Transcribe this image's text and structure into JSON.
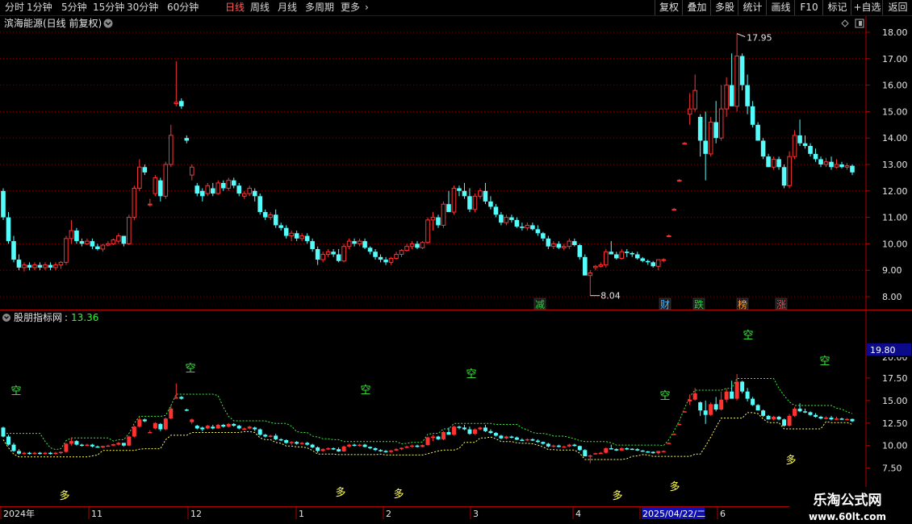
{
  "periods": [
    {
      "label": "分时",
      "active": false
    },
    {
      "label": "1分钟",
      "active": false
    },
    {
      "label": "5分钟",
      "active": false
    },
    {
      "label": "15分钟",
      "active": false
    },
    {
      "label": "30分钟",
      "active": false
    },
    {
      "label": "60分钟",
      "active": false
    },
    {
      "label": "日线",
      "active": true
    },
    {
      "label": "周线",
      "active": false
    },
    {
      "label": "月线",
      "active": false
    },
    {
      "label": "多周期",
      "active": false
    },
    {
      "label": "更多",
      "active": false
    }
  ],
  "more_chevron": "›",
  "toolbar": [
    "复权",
    "叠加",
    "多股",
    "统计",
    "画线",
    "F10",
    "标记",
    "+自选",
    "返回"
  ],
  "main": {
    "title": "滨海能源(日线 前复权)",
    "high_label": "17.95",
    "low_label": "8.04",
    "y_ticks": [
      "18.00",
      "17.00",
      "16.00",
      "15.00",
      "14.00",
      "13.00",
      "12.00",
      "11.00",
      "10.00",
      "9.00",
      "8.00"
    ],
    "events": [
      {
        "text": "减",
        "color": "#2ecc40"
      },
      {
        "text": "财",
        "color": "#4ab8ff"
      },
      {
        "text": "跌",
        "color": "#2ecc40"
      },
      {
        "text": "榜",
        "color": "#ffa040"
      },
      {
        "text": "涨",
        "color": "#ff4040"
      }
    ]
  },
  "indicator": {
    "name": "股朋指标网",
    "value": "13.36",
    "current_tag": "19.80",
    "y_ticks": [
      "17.50",
      "15.00",
      "12.50",
      "10.00",
      "7.50"
    ],
    "partial_tick": "20.00",
    "kong_label": "空",
    "duo_label": "多"
  },
  "dates": [
    "2024年",
    "11",
    "12",
    "1",
    "2",
    "3",
    "4",
    "2025/04/22/二",
    "6"
  ],
  "watermark": {
    "title": "乐淘公式网",
    "url": "www.60lt.com"
  },
  "colors": {
    "up": "#ff3232",
    "down": "#54fcfc",
    "grid": "#8a0000",
    "axis": "#b00000",
    "kong": "#3cf03c",
    "duo": "#ffff50"
  },
  "chart_data": {
    "type": "candlestick",
    "ylim": [
      7.8,
      18.3
    ],
    "candles": [
      [
        12.0,
        12.1,
        10.9,
        11.0
      ],
      [
        11.0,
        11.2,
        10.0,
        10.1
      ],
      [
        10.1,
        10.3,
        9.3,
        9.4
      ],
      [
        9.4,
        9.6,
        9.0,
        9.1
      ],
      [
        9.1,
        9.3,
        8.95,
        9.2
      ],
      [
        9.2,
        9.3,
        9.0,
        9.1
      ],
      [
        9.1,
        9.3,
        9.0,
        9.2
      ],
      [
        9.2,
        9.3,
        9.0,
        9.1
      ],
      [
        9.1,
        9.3,
        9.0,
        9.2
      ],
      [
        9.2,
        9.3,
        9.0,
        9.1
      ],
      [
        9.1,
        9.3,
        9.0,
        9.2
      ],
      [
        9.2,
        9.35,
        9.05,
        9.3
      ],
      [
        9.3,
        10.3,
        9.2,
        10.2
      ],
      [
        10.2,
        10.9,
        10.0,
        10.5
      ],
      [
        10.5,
        10.6,
        10.0,
        10.1
      ],
      [
        10.1,
        10.2,
        9.9,
        10.0
      ],
      [
        10.0,
        10.2,
        9.95,
        10.1
      ],
      [
        10.1,
        10.2,
        9.8,
        9.9
      ],
      [
        9.9,
        10.0,
        9.75,
        9.8
      ],
      [
        9.8,
        10.0,
        9.7,
        9.95
      ],
      [
        9.95,
        10.1,
        9.9,
        10.0
      ],
      [
        10.0,
        10.2,
        9.95,
        10.15
      ],
      [
        10.1,
        10.4,
        10.0,
        10.3
      ],
      [
        10.3,
        10.2,
        9.9,
        10.0
      ],
      [
        10.0,
        11.1,
        9.95,
        11.0
      ],
      [
        11.0,
        12.2,
        10.9,
        12.1
      ],
      [
        12.1,
        13.2,
        12.0,
        12.9
      ],
      [
        12.9,
        13.0,
        12.6,
        12.7
      ],
      [
        11.5,
        11.7,
        11.4,
        11.5
      ],
      [
        11.9,
        12.6,
        11.8,
        12.5
      ],
      [
        12.4,
        12.5,
        11.6,
        11.8
      ],
      [
        11.8,
        13.1,
        11.7,
        13.0
      ],
      [
        13.0,
        14.5,
        12.9,
        14.1
      ],
      [
        15.3,
        16.9,
        15.2,
        15.35
      ],
      [
        15.4,
        15.5,
        15.1,
        15.2
      ],
      [
        14.0,
        14.1,
        13.8,
        13.9
      ],
      [
        12.6,
        13.0,
        12.4,
        12.9
      ],
      [
        12.2,
        12.3,
        11.8,
        11.9
      ],
      [
        12.0,
        12.1,
        11.6,
        11.8
      ],
      [
        11.9,
        12.3,
        11.8,
        12.2
      ],
      [
        12.1,
        12.3,
        11.8,
        11.9
      ],
      [
        11.9,
        12.4,
        11.85,
        12.3
      ],
      [
        12.3,
        12.4,
        12.0,
        12.1
      ],
      [
        12.1,
        12.5,
        12.0,
        12.4
      ],
      [
        12.4,
        12.5,
        12.1,
        12.2
      ],
      [
        12.2,
        12.3,
        11.8,
        11.9
      ],
      [
        11.8,
        12.0,
        11.7,
        11.9
      ],
      [
        11.9,
        12.2,
        11.8,
        12.1
      ],
      [
        12.0,
        12.1,
        11.6,
        11.8
      ],
      [
        11.8,
        11.9,
        11.1,
        11.2
      ],
      [
        11.2,
        11.3,
        10.9,
        11.0
      ],
      [
        11.0,
        11.2,
        10.9,
        11.1
      ],
      [
        11.1,
        11.3,
        10.6,
        10.7
      ],
      [
        10.7,
        10.8,
        10.5,
        10.6
      ],
      [
        10.6,
        10.7,
        10.2,
        10.3
      ],
      [
        10.3,
        10.5,
        10.1,
        10.4
      ],
      [
        10.4,
        10.5,
        10.1,
        10.2
      ],
      [
        10.2,
        10.4,
        10.1,
        10.3
      ],
      [
        10.3,
        10.4,
        10.0,
        10.1
      ],
      [
        10.1,
        10.2,
        9.7,
        9.8
      ],
      [
        9.8,
        9.9,
        9.2,
        9.4
      ],
      [
        9.4,
        9.7,
        9.3,
        9.6
      ],
      [
        9.6,
        9.8,
        9.5,
        9.7
      ],
      [
        9.7,
        9.8,
        9.5,
        9.6
      ],
      [
        9.6,
        9.8,
        9.3,
        9.35
      ],
      [
        9.35,
        10.0,
        9.3,
        9.9
      ],
      [
        9.9,
        10.2,
        9.8,
        10.1
      ],
      [
        10.1,
        10.2,
        9.9,
        10.0
      ],
      [
        10.0,
        10.2,
        9.9,
        10.1
      ],
      [
        10.1,
        10.2,
        9.8,
        9.85
      ],
      [
        9.85,
        9.9,
        9.6,
        9.7
      ],
      [
        9.7,
        9.8,
        9.4,
        9.5
      ],
      [
        9.5,
        9.6,
        9.3,
        9.4
      ],
      [
        9.4,
        9.5,
        9.2,
        9.3
      ],
      [
        9.3,
        9.5,
        9.2,
        9.45
      ],
      [
        9.45,
        9.7,
        9.4,
        9.6
      ],
      [
        9.6,
        9.8,
        9.5,
        9.75
      ],
      [
        9.75,
        10.0,
        9.7,
        9.9
      ],
      [
        9.9,
        10.1,
        9.8,
        10.0
      ],
      [
        10.0,
        10.1,
        9.8,
        9.85
      ],
      [
        9.85,
        10.1,
        9.8,
        10.05
      ],
      [
        10.05,
        11.0,
        10.0,
        10.9
      ],
      [
        10.9,
        11.2,
        10.5,
        11.0
      ],
      [
        11.0,
        11.1,
        10.6,
        10.7
      ],
      [
        10.7,
        11.6,
        10.6,
        11.5
      ],
      [
        11.5,
        12.0,
        11.4,
        11.2
      ],
      [
        11.2,
        12.2,
        11.1,
        12.1
      ],
      [
        12.1,
        12.2,
        11.8,
        12.0
      ],
      [
        12.0,
        12.3,
        11.7,
        11.8
      ],
      [
        11.8,
        12.1,
        11.2,
        11.3
      ],
      [
        11.3,
        11.9,
        11.2,
        11.8
      ],
      [
        11.8,
        12.1,
        11.7,
        12.0
      ],
      [
        12.0,
        12.3,
        11.5,
        11.6
      ],
      [
        11.6,
        11.8,
        11.3,
        11.4
      ],
      [
        11.4,
        11.5,
        11.0,
        11.1
      ],
      [
        11.1,
        11.2,
        10.7,
        10.8
      ],
      [
        10.8,
        11.1,
        10.7,
        11.0
      ],
      [
        11.0,
        11.1,
        10.8,
        10.9
      ],
      [
        10.9,
        11.0,
        10.6,
        10.65
      ],
      [
        10.65,
        10.8,
        10.5,
        10.6
      ],
      [
        10.6,
        10.8,
        10.5,
        10.7
      ],
      [
        10.7,
        10.8,
        10.5,
        10.55
      ],
      [
        10.55,
        10.7,
        10.3,
        10.4
      ],
      [
        10.4,
        10.45,
        10.1,
        10.2
      ],
      [
        10.2,
        10.3,
        9.8,
        9.9
      ],
      [
        9.9,
        10.1,
        9.8,
        10.0
      ],
      [
        10.0,
        10.1,
        9.8,
        9.85
      ],
      [
        9.85,
        10.0,
        9.75,
        9.9
      ],
      [
        9.9,
        10.2,
        9.8,
        10.1
      ],
      [
        10.1,
        10.2,
        9.9,
        9.95
      ],
      [
        9.95,
        10.0,
        9.4,
        9.5
      ],
      [
        9.5,
        9.6,
        9.0,
        8.8
      ],
      [
        8.8,
        9.0,
        8.04,
        8.9
      ],
      [
        9.1,
        9.2,
        9.0,
        9.15
      ],
      [
        9.15,
        9.3,
        9.1,
        9.2
      ],
      [
        9.2,
        9.8,
        9.1,
        9.7
      ],
      [
        9.7,
        10.1,
        9.6,
        9.6
      ],
      [
        9.6,
        9.7,
        9.4,
        9.45
      ],
      [
        9.45,
        9.8,
        9.4,
        9.7
      ],
      [
        9.7,
        9.8,
        9.5,
        9.65
      ],
      [
        9.65,
        9.7,
        9.5,
        9.6
      ],
      [
        9.6,
        9.7,
        9.4,
        9.45
      ],
      [
        9.45,
        9.5,
        9.3,
        9.35
      ],
      [
        9.35,
        9.4,
        9.2,
        9.3
      ],
      [
        9.3,
        9.35,
        9.1,
        9.15
      ],
      [
        9.15,
        9.4,
        9.0,
        9.4
      ],
      [
        9.4,
        9.45,
        9.3,
        9.4
      ],
      [
        10.3,
        10.35,
        10.25,
        10.3
      ],
      [
        11.3,
        11.35,
        11.25,
        11.3
      ],
      [
        12.4,
        12.45,
        12.35,
        12.4
      ],
      [
        13.8,
        13.85,
        13.75,
        13.8
      ],
      [
        14.9,
        15.7,
        14.5,
        15.1
      ],
      [
        15.1,
        16.4,
        15.0,
        15.8
      ],
      [
        14.8,
        14.9,
        13.3,
        13.9
      ],
      [
        13.9,
        15.0,
        12.4,
        13.4
      ],
      [
        13.4,
        14.8,
        13.3,
        14.6
      ],
      [
        14.6,
        15.4,
        13.8,
        14.0
      ],
      [
        14.0,
        16.0,
        13.9,
        15.1
      ],
      [
        15.1,
        16.3,
        14.8,
        16.0
      ],
      [
        16.0,
        17.2,
        15.5,
        15.2
      ],
      [
        15.2,
        17.95,
        15.0,
        17.1
      ],
      [
        17.1,
        17.2,
        15.8,
        16.0
      ],
      [
        16.0,
        16.4,
        14.9,
        15.2
      ],
      [
        15.2,
        15.4,
        14.4,
        14.5
      ],
      [
        14.5,
        14.6,
        13.9,
        13.9
      ],
      [
        13.9,
        14.0,
        13.2,
        13.3
      ],
      [
        13.3,
        13.4,
        12.9,
        12.9
      ],
      [
        12.9,
        13.3,
        12.8,
        13.2
      ],
      [
        13.2,
        13.3,
        12.8,
        12.9
      ],
      [
        12.9,
        13.0,
        12.1,
        12.2
      ],
      [
        12.2,
        13.5,
        12.1,
        13.3
      ],
      [
        13.3,
        14.3,
        13.2,
        14.1
      ],
      [
        14.1,
        14.7,
        13.7,
        13.8
      ],
      [
        13.8,
        14.1,
        13.6,
        13.7
      ],
      [
        13.7,
        13.8,
        13.3,
        13.4
      ],
      [
        13.4,
        13.6,
        13.1,
        13.2
      ],
      [
        13.2,
        13.3,
        12.9,
        13.0
      ],
      [
        13.0,
        13.25,
        12.9,
        13.1
      ],
      [
        13.1,
        13.3,
        12.8,
        12.9
      ],
      [
        12.9,
        13.2,
        12.85,
        13.0
      ],
      [
        13.0,
        13.1,
        12.85,
        12.9
      ],
      [
        12.9,
        13.05,
        12.8,
        12.95
      ],
      [
        12.95,
        13.0,
        12.6,
        12.7
      ]
    ]
  }
}
